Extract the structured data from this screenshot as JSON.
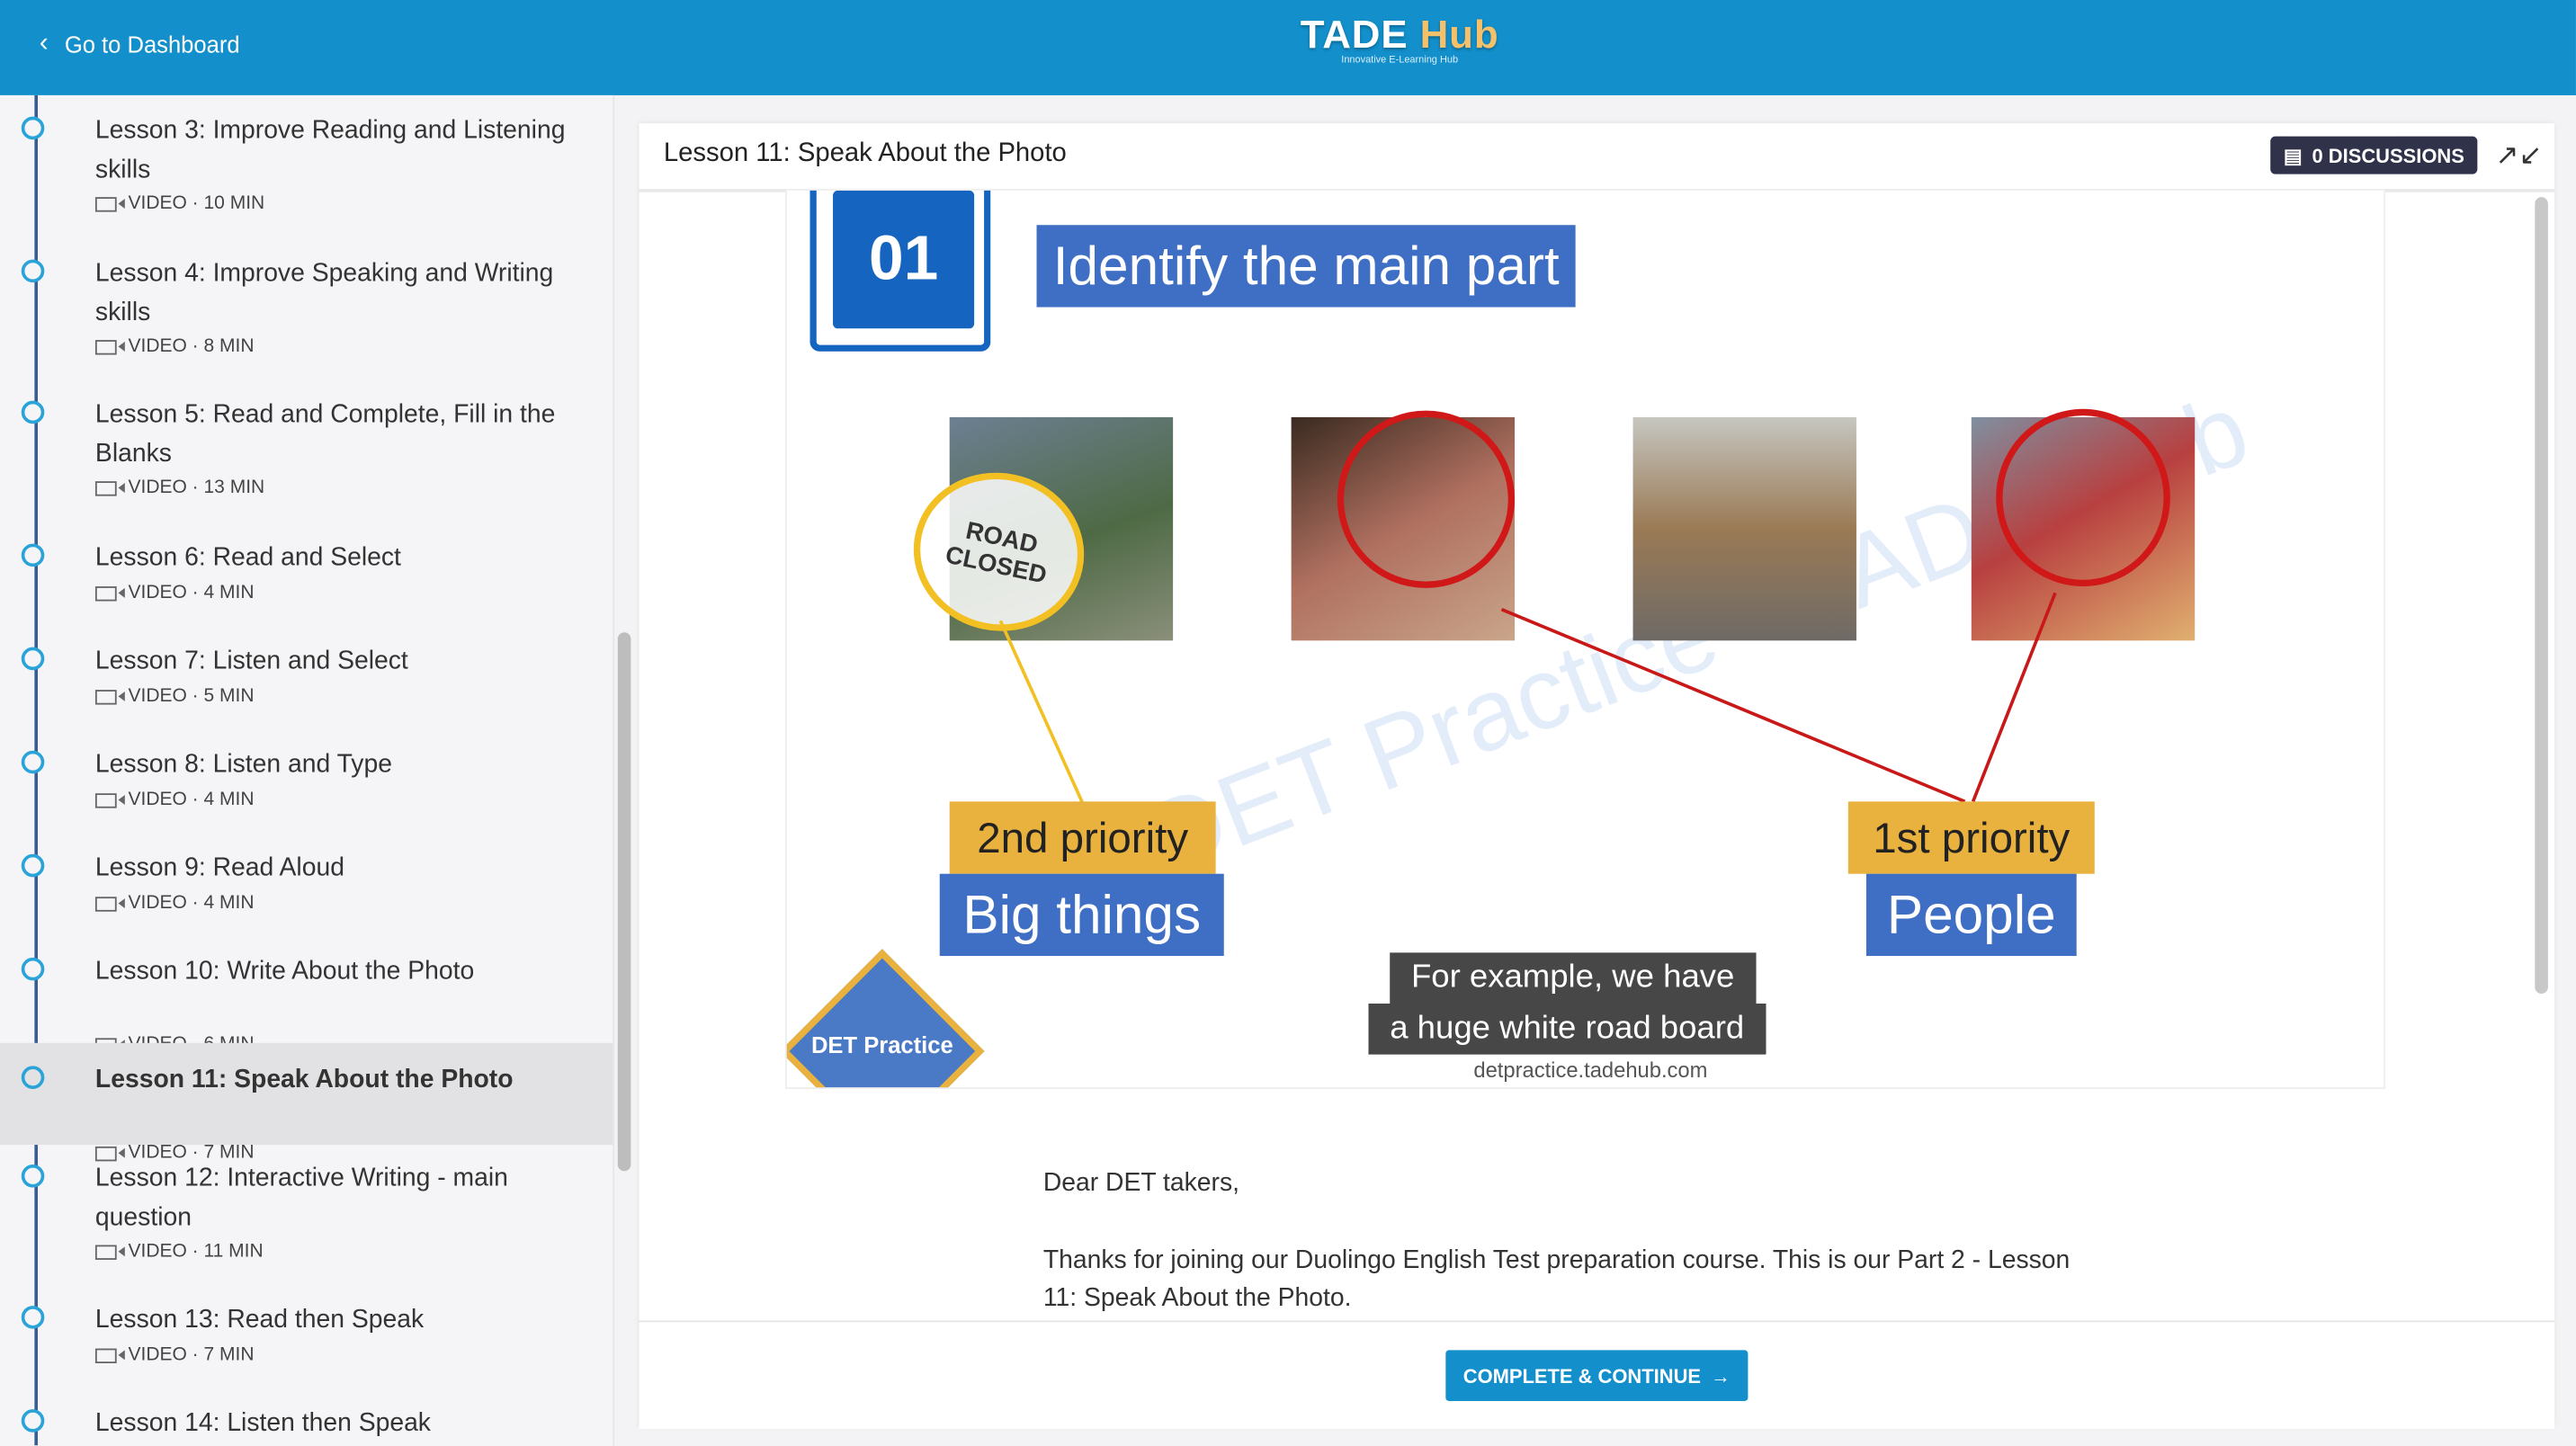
{
  "header": {
    "back_label": "Go to Dashboard",
    "logo_main": "TADE",
    "logo_accent": "Hub",
    "logo_tagline": "Innovative E-Learning Hub",
    "color": "#1390cc"
  },
  "sidebar": {
    "items": [
      {
        "title": "Lesson 3: Improve Reading and Listening skills",
        "meta": "VIDEO · 10 MIN"
      },
      {
        "title": "Lesson 4: Improve Speaking and Writing skills",
        "meta": "VIDEO · 8 MIN"
      },
      {
        "title": "Lesson 5: Read and Complete, Fill in the Blanks",
        "meta": "VIDEO · 13 MIN"
      },
      {
        "title": "Lesson 6: Read and Select",
        "meta": "VIDEO · 4 MIN"
      },
      {
        "title": "Lesson 7: Listen and Select",
        "meta": "VIDEO · 5 MIN"
      },
      {
        "title": "Lesson 8: Listen and Type",
        "meta": "VIDEO · 4 MIN"
      },
      {
        "title": "Lesson 9: Read Aloud",
        "meta": "VIDEO · 4 MIN"
      },
      {
        "title": "Lesson 10: Write About the Photo",
        "meta": "VIDEO · 6 MIN"
      },
      {
        "title": "Lesson 11: Speak About the Photo",
        "meta": "VIDEO · 7 MIN",
        "active": true
      },
      {
        "title": "Lesson 12: Interactive Writing - main question",
        "meta": "VIDEO · 11 MIN"
      },
      {
        "title": "Lesson 13: Read then Speak",
        "meta": "VIDEO · 7 MIN"
      },
      {
        "title": "Lesson 14: Listen then Speak",
        "meta": ""
      }
    ]
  },
  "main": {
    "title": "Lesson 11: Speak About the Photo",
    "discussions_label": "0 DISCUSSIONS",
    "slide": {
      "number": "01",
      "heading": "Identify the main part",
      "watermark": "DET Practice - TADE Hub",
      "road_sign": "ROAD CLOSED",
      "tag1_priority": "2nd priority",
      "tag1_label": "Big things",
      "tag2_priority": "1st priority",
      "tag2_label": "People",
      "badge": "DET Practice",
      "caption_line1": "For example, we have",
      "caption_line2": "a huge white road board",
      "site": "detpractice.tadehub.com"
    },
    "body": {
      "greeting": "Dear DET takers,",
      "paragraph": "Thanks for joining our Duolingo English Test preparation course. This is our Part 2 - Lesson 11: Speak About the Photo."
    },
    "complete_label": "COMPLETE & CONTINUE"
  }
}
